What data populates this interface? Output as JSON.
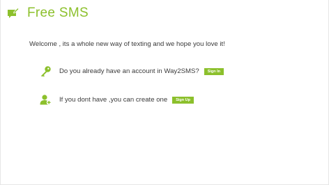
{
  "header": {
    "icon": "sms-pencil-icon",
    "title": "Free SMS"
  },
  "welcome_text": "Welcome , its a whole new way of texting and we hope you love it!",
  "signin_row": {
    "icon": "key-icon",
    "text": "Do you already have an account in Way2SMS?",
    "button_label": "Sign In"
  },
  "signup_row": {
    "icon": "add-user-icon",
    "text": "If you dont have ,you can create one",
    "button_label": "Sign Up"
  },
  "colors": {
    "accent": "#8cc02c",
    "text": "#3a3a3a",
    "background": "#ffffff"
  }
}
